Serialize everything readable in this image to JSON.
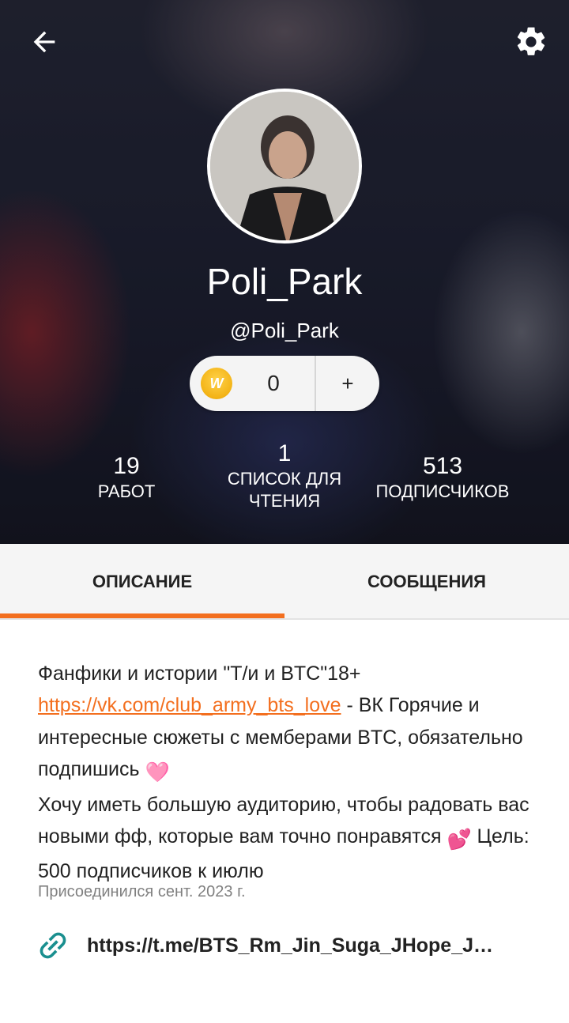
{
  "profile": {
    "display_name": "Poli_Park",
    "username": "@Poli_Park"
  },
  "coins": {
    "value": "0",
    "add_label": "+",
    "coin_glyph": "W"
  },
  "stats": [
    {
      "value": "19",
      "label": "РАБОТ"
    },
    {
      "value": "1",
      "label": "СПИСОК ДЛЯ ЧТЕНИЯ"
    },
    {
      "value": "513",
      "label": "ПОДПИСЧИКОВ"
    }
  ],
  "tabs": [
    {
      "label": "ОПИСАНИЕ",
      "active": true
    },
    {
      "label": "СООБЩЕНИЯ",
      "active": false
    }
  ],
  "about": {
    "line1": "Фанфики и истории \"Т/и и BTC\"18+",
    "link": "https://vk.com/club_army_bts_love",
    "after_link": " - ВК Горячие и интересные сюжеты с мемберами BTC, обязательно подпишись ",
    "emoji1": "🩷",
    "text2": "Хочу иметь большую аудиторию, чтобы радовать вас новыми фф, которые вам точно понравятся ",
    "emoji2": "💕",
    "text3": " Цель: 500 подписчиков к июлю",
    "joined": "Присоединился сент. 2023 г."
  },
  "external_link": {
    "url": "https://t.me/BTS_Rm_Jin_Suga_JHope_J…",
    "icon": "link-icon"
  },
  "colors": {
    "accent": "#f36f1f",
    "link_icon": "#1a8f8f"
  }
}
